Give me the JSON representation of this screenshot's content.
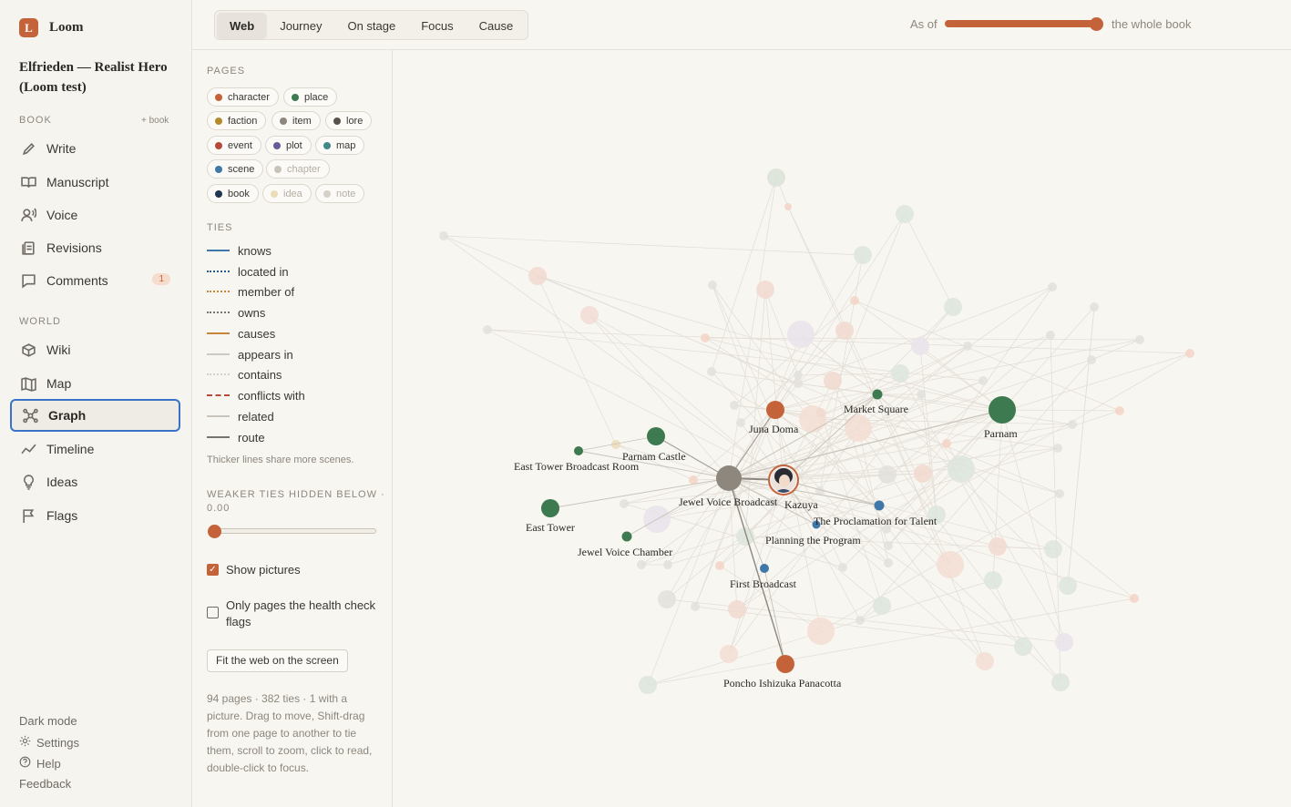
{
  "app": {
    "name": "Loom",
    "logo_letter": "L"
  },
  "book": {
    "title": "Elfrieden — Realist Hero (Loom test)"
  },
  "sidebar": {
    "book_section": "BOOK",
    "add_book": "+ book",
    "book_items": [
      {
        "label": "Write",
        "icon": "pencil-icon"
      },
      {
        "label": "Manuscript",
        "icon": "book-open-icon"
      },
      {
        "label": "Voice",
        "icon": "voice-icon"
      },
      {
        "label": "Revisions",
        "icon": "revisions-icon"
      },
      {
        "label": "Comments",
        "icon": "comment-icon",
        "badge": "1"
      }
    ],
    "world_section": "WORLD",
    "world_items": [
      {
        "label": "Wiki",
        "icon": "wiki-icon"
      },
      {
        "label": "Map",
        "icon": "map-icon"
      },
      {
        "label": "Graph",
        "icon": "graph-icon",
        "active": true
      },
      {
        "label": "Timeline",
        "icon": "timeline-icon"
      },
      {
        "label": "Ideas",
        "icon": "lightbulb-icon"
      },
      {
        "label": "Flags",
        "icon": "flag-icon"
      }
    ],
    "bottom": {
      "dark_mode": "Dark mode",
      "settings": "Settings",
      "help": "Help",
      "feedback": "Feedback"
    }
  },
  "topbar": {
    "tabs": [
      "Web",
      "Journey",
      "On stage",
      "Focus",
      "Cause"
    ],
    "active_tab": "Web",
    "asof_label": "As of",
    "asof_end": "the whole book",
    "asof_value": 1.0
  },
  "panel": {
    "pages_label": "PAGES",
    "pages": [
      {
        "label": "character",
        "color": "#c4633a",
        "on": true
      },
      {
        "label": "place",
        "color": "#3d7a4f",
        "on": true
      },
      {
        "label": "faction",
        "color": "#b58a2e",
        "on": true
      },
      {
        "label": "item",
        "color": "#8d877d",
        "on": true
      },
      {
        "label": "lore",
        "color": "#5a534b",
        "on": true
      },
      {
        "label": "event",
        "color": "#b5493a",
        "on": true
      },
      {
        "label": "plot",
        "color": "#6a5a9a",
        "on": true
      },
      {
        "label": "map",
        "color": "#3f8a86",
        "on": true
      },
      {
        "label": "scene",
        "color": "#3f78a8",
        "on": true
      },
      {
        "label": "chapter",
        "color": "#c8c2b8",
        "on": false
      },
      {
        "label": "book",
        "color": "#1f3550",
        "on": true
      },
      {
        "label": "idea",
        "color": "#ecdcb8",
        "on": false
      },
      {
        "label": "note",
        "color": "#d6d1c8",
        "on": false
      }
    ],
    "ties_label": "TIES",
    "ties": [
      {
        "label": "knows",
        "color": "#3f78a8",
        "style": "solid"
      },
      {
        "label": "located in",
        "color": "#2a5a8a",
        "style": "dotted"
      },
      {
        "label": "member of",
        "color": "#c8843a",
        "style": "dotted"
      },
      {
        "label": "owns",
        "color": "#7a746b",
        "style": "dotted"
      },
      {
        "label": "causes",
        "color": "#c8843a",
        "style": "solid"
      },
      {
        "label": "appears in",
        "color": "#cfcac1",
        "style": "solid"
      },
      {
        "label": "contains",
        "color": "#d6d1c8",
        "style": "dotted"
      },
      {
        "label": "conflicts with",
        "color": "#b5493a",
        "style": "dashed"
      },
      {
        "label": "related",
        "color": "#c9c4bb",
        "style": "solid"
      },
      {
        "label": "route",
        "color": "#7a746b",
        "style": "solid"
      }
    ],
    "ties_note": "Thicker lines share more scenes.",
    "weaker_label": "WEAKER TIES HIDDEN BELOW ·",
    "weaker_value": "0.00",
    "show_pictures": "Show pictures",
    "show_pictures_checked": true,
    "only_flagged": "Only pages the health check flags",
    "only_flagged_checked": false,
    "fit_button": "Fit the web on the screen",
    "info": "94 pages · 382 ties · 1 with a picture. Drag to move, Shift-drag from one page to another to tie them, scroll to zoom, click to read, double-click to focus."
  },
  "graph": {
    "nodes": [
      {
        "label": "Jewel Voice Broadcast",
        "type": "item",
        "color": "#8d877d"
      },
      {
        "label": "Kazuya",
        "type": "character",
        "color": "#c4633a",
        "picture": true
      },
      {
        "label": "Juna Doma",
        "type": "character",
        "color": "#c4633a"
      },
      {
        "label": "Market Square",
        "type": "place",
        "color": "#3d7a4f"
      },
      {
        "label": "Parnam",
        "type": "place",
        "color": "#3d7a4f"
      },
      {
        "label": "Parnam Castle",
        "type": "place",
        "color": "#3d7a4f"
      },
      {
        "label": "East Tower Broadcast Room",
        "type": "place",
        "color": "#3d7a4f"
      },
      {
        "label": "East Tower",
        "type": "place",
        "color": "#3d7a4f"
      },
      {
        "label": "Jewel Voice Chamber",
        "type": "place",
        "color": "#3d7a4f"
      },
      {
        "label": "The Proclamation for Talent",
        "type": "scene",
        "color": "#3f78a8"
      },
      {
        "label": "Planning the Program",
        "type": "scene",
        "color": "#3f78a8"
      },
      {
        "label": "First Broadcast",
        "type": "scene",
        "color": "#3f78a8"
      },
      {
        "label": "Poncho Ishizuka Panacotta",
        "type": "character",
        "color": "#c4633a"
      }
    ]
  }
}
